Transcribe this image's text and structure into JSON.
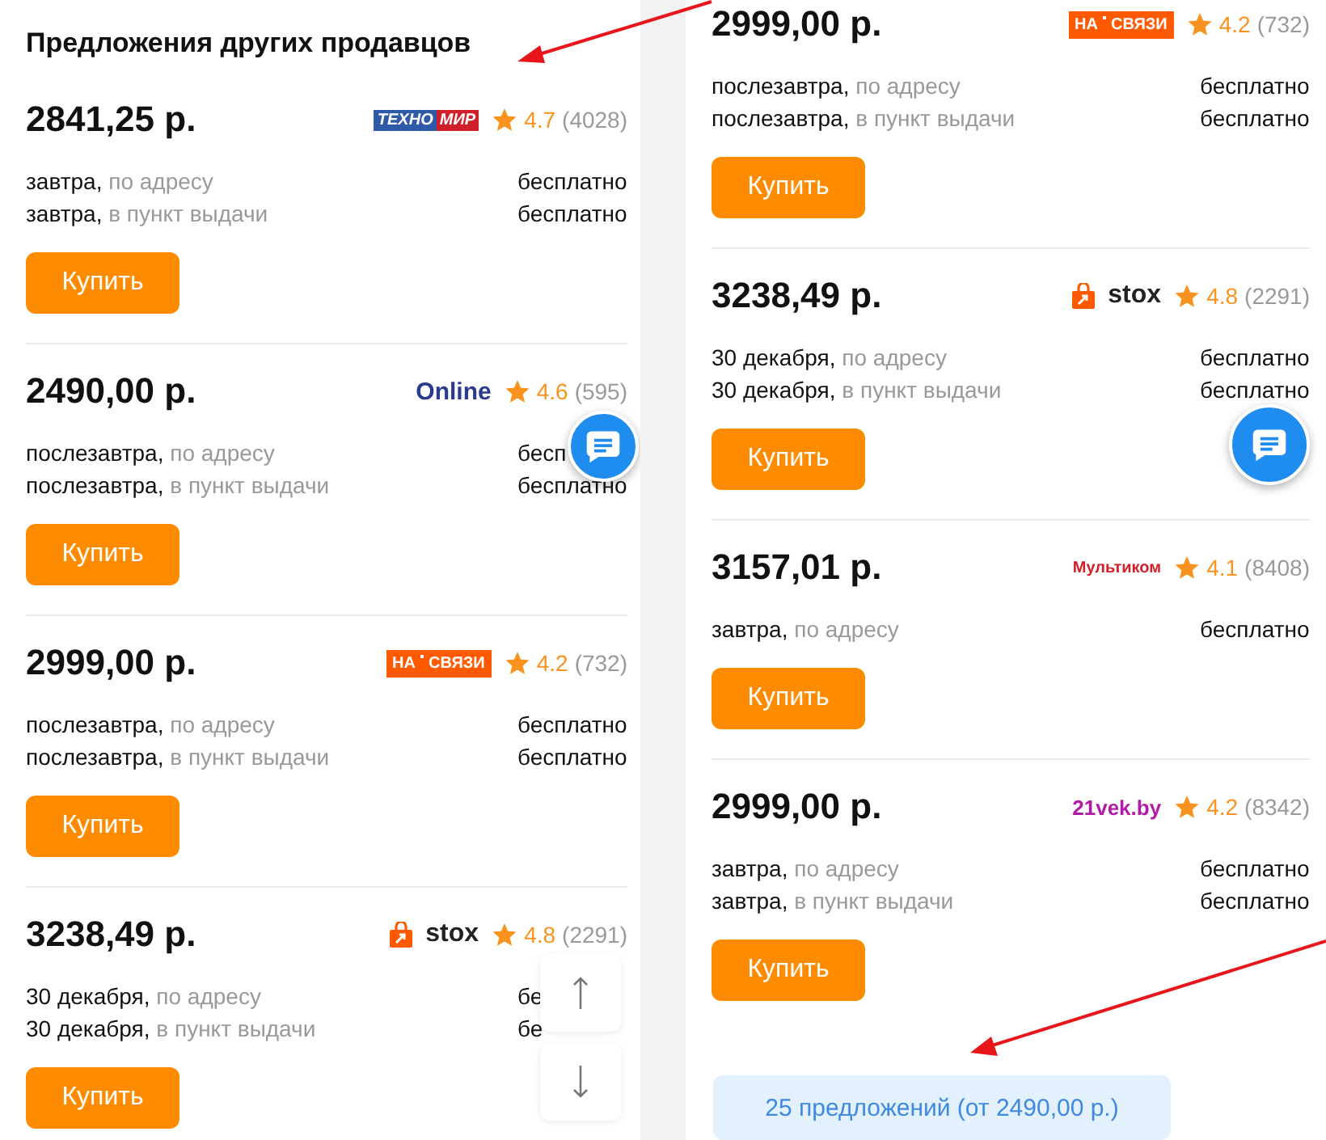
{
  "panels": [
    {
      "heading": "Предложения других продавцов",
      "scroll_controls": true,
      "offers": [
        {
          "price": "2841,25 р.",
          "seller": {
            "kind": "tehnomir",
            "logo_parts": [
              "ТЕХНО",
              "МИР"
            ]
          },
          "rating": "4.7",
          "reviews": "(4028)",
          "deliveries": [
            {
              "date": "завтра,",
              "method": "по адресу",
              "cost": "бесплатно"
            },
            {
              "date": "завтра,",
              "method": "в пункт выдачи",
              "cost": "бесплатно"
            }
          ],
          "button": "Купить"
        },
        {
          "price": "2490,00 р.",
          "seller": {
            "kind": "online",
            "logo_parts": [
              "Online"
            ]
          },
          "rating": "4.6",
          "reviews": "(595)",
          "deliveries": [
            {
              "date": "послезавтра,",
              "method": "по адресу",
              "cost": "бесп"
            },
            {
              "date": "послезавтра,",
              "method": "в пункт выдачи",
              "cost": "бесплатно"
            }
          ],
          "button": "Купить"
        },
        {
          "price": "2999,00 р.",
          "seller": {
            "kind": "nasvyazi",
            "logo_parts": [
              "НА",
              "СВЯЗИ"
            ]
          },
          "rating": "4.2",
          "reviews": "(732)",
          "deliveries": [
            {
              "date": "послезавтра,",
              "method": "по адресу",
              "cost": "бесплатно"
            },
            {
              "date": "послезавтра,",
              "method": "в пункт выдачи",
              "cost": "бесплатно"
            }
          ],
          "button": "Купить"
        },
        {
          "price": "3238,49 р.",
          "seller": {
            "kind": "stox",
            "logo_parts": [
              "stox"
            ]
          },
          "rating": "4.8",
          "reviews": "(2291)",
          "deliveries": [
            {
              "date": "30 декабря,",
              "method": "по адресу",
              "cost": "бе"
            },
            {
              "date": "30 декабря,",
              "method": "в пункт выдачи",
              "cost": "бе"
            }
          ],
          "button": "Купить"
        }
      ]
    },
    {
      "scroll_controls": false,
      "offers": [
        {
          "price": "2999,00 р.",
          "seller": {
            "kind": "nasvyazi",
            "logo_parts": [
              "НА",
              "СВЯЗИ"
            ]
          },
          "rating": "4.2",
          "reviews": "(732)",
          "deliveries": [
            {
              "date": "послезавтра,",
              "method": "по адресу",
              "cost": "бесплатно"
            },
            {
              "date": "послезавтра,",
              "method": "в пункт выдачи",
              "cost": "бесплатно"
            }
          ],
          "button": "Купить"
        },
        {
          "price": "3238,49 р.",
          "seller": {
            "kind": "stox",
            "logo_parts": [
              "stox"
            ]
          },
          "rating": "4.8",
          "reviews": "(2291)",
          "deliveries": [
            {
              "date": "30 декабря,",
              "method": "по адресу",
              "cost": "бесплатно"
            },
            {
              "date": "30 декабря,",
              "method": "в пункт выдачи",
              "cost": "бесплатно"
            }
          ],
          "button": "Купить"
        },
        {
          "price": "3157,01 р.",
          "seller": {
            "kind": "multicom",
            "logo_parts": [
              "Мультиком"
            ]
          },
          "rating": "4.1",
          "reviews": "(8408)",
          "deliveries": [
            {
              "date": "завтра,",
              "method": "по адресу",
              "cost": "бесплатно"
            }
          ],
          "button": "Купить"
        },
        {
          "price": "2999,00 р.",
          "seller": {
            "kind": "vek",
            "logo_parts": [
              "21vek.by"
            ]
          },
          "rating": "4.2",
          "reviews": "(8342)",
          "deliveries": [
            {
              "date": "завтра,",
              "method": "по адресу",
              "cost": "бесплатно"
            },
            {
              "date": "завтра,",
              "method": "в пункт выдачи",
              "cost": "бесплатно"
            }
          ],
          "button": "Купить"
        }
      ],
      "more_link": "25 предложений (от 2490,00 р.)"
    }
  ]
}
